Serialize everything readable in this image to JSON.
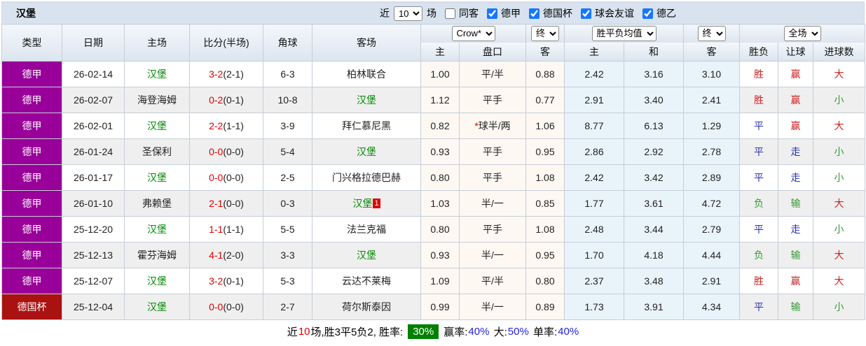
{
  "header": {
    "title": "汉堡",
    "near_label": "近",
    "games_count": "10",
    "games_label": "场",
    "same_away_label": "同客",
    "leagues": [
      "德甲",
      "德国杯",
      "球会友谊",
      "德乙"
    ]
  },
  "selects": {
    "bookmaker": "Crow*",
    "state1": "终",
    "avg": "胜平负均值",
    "state2": "终",
    "scope": "全场"
  },
  "columns": {
    "type": "类型",
    "date": "日期",
    "home": "主场",
    "score": "比分(半场)",
    "corner": "角球",
    "away": "客场",
    "odds_home": "主",
    "handicap": "盘口",
    "odds_away": "客",
    "avg_home": "主",
    "avg_draw": "和",
    "avg_away": "客",
    "result": "胜负",
    "give": "让球",
    "goals": "进球数"
  },
  "rows": [
    {
      "league": "德甲",
      "league_cls": "lg-jia",
      "date": "26-02-14",
      "home": "汉堡",
      "home_cls": "team",
      "score": "3-2",
      "half": "(2-1)",
      "corners": "6-3",
      "away": "柏林联合",
      "away_cls": "",
      "away_badge": "",
      "odds_home": "1.00",
      "star": "",
      "handicap": "平/半",
      "odds_away": "0.88",
      "avg_home": "2.42",
      "avg_draw": "3.16",
      "avg_away": "3.10",
      "result": "胜",
      "result_cls": "t-red",
      "give": "赢",
      "give_cls": "t-red",
      "goals": "大",
      "goals_cls": "t-red"
    },
    {
      "league": "德甲",
      "league_cls": "lg-jia",
      "date": "26-02-07",
      "home": "海登海姆",
      "home_cls": "",
      "score": "0-2",
      "half": "(0-1)",
      "corners": "10-8",
      "away": "汉堡",
      "away_cls": "team",
      "away_badge": "",
      "odds_home": "1.12",
      "star": "",
      "handicap": "平手",
      "odds_away": "0.77",
      "avg_home": "2.91",
      "avg_draw": "3.40",
      "avg_away": "2.41",
      "result": "胜",
      "result_cls": "t-red",
      "give": "赢",
      "give_cls": "t-red",
      "goals": "小",
      "goals_cls": "t-green"
    },
    {
      "league": "德甲",
      "league_cls": "lg-jia",
      "date": "26-02-01",
      "home": "汉堡",
      "home_cls": "team",
      "score": "2-2",
      "half": "(1-1)",
      "corners": "3-9",
      "away": "拜仁慕尼黑",
      "away_cls": "",
      "away_badge": "",
      "odds_home": "0.82",
      "star": "*",
      "handicap": "球半/两",
      "odds_away": "1.06",
      "avg_home": "8.77",
      "avg_draw": "6.13",
      "avg_away": "1.29",
      "result": "平",
      "result_cls": "t-blue",
      "give": "赢",
      "give_cls": "t-red",
      "goals": "大",
      "goals_cls": "t-red"
    },
    {
      "league": "德甲",
      "league_cls": "lg-jia",
      "date": "26-01-24",
      "home": "圣保利",
      "home_cls": "",
      "score": "0-0",
      "half": "(0-0)",
      "corners": "5-4",
      "away": "汉堡",
      "away_cls": "team",
      "away_badge": "",
      "odds_home": "0.93",
      "star": "",
      "handicap": "平手",
      "odds_away": "0.95",
      "avg_home": "2.86",
      "avg_draw": "2.92",
      "avg_away": "2.78",
      "result": "平",
      "result_cls": "t-blue",
      "give": "走",
      "give_cls": "t-blue",
      "goals": "小",
      "goals_cls": "t-green"
    },
    {
      "league": "德甲",
      "league_cls": "lg-jia",
      "date": "26-01-17",
      "home": "汉堡",
      "home_cls": "team",
      "score": "0-0",
      "half": "(0-0)",
      "corners": "2-5",
      "away": "门兴格拉德巴赫",
      "away_cls": "",
      "away_badge": "",
      "odds_home": "0.80",
      "star": "",
      "handicap": "平手",
      "odds_away": "1.08",
      "avg_home": "2.42",
      "avg_draw": "3.42",
      "avg_away": "2.89",
      "result": "平",
      "result_cls": "t-blue",
      "give": "走",
      "give_cls": "t-blue",
      "goals": "小",
      "goals_cls": "t-green"
    },
    {
      "league": "德甲",
      "league_cls": "lg-jia",
      "date": "26-01-10",
      "home": "弗赖堡",
      "home_cls": "",
      "score": "2-1",
      "half": "(0-0)",
      "corners": "0-3",
      "away": "汉堡",
      "away_cls": "team",
      "away_badge": "1",
      "odds_home": "1.03",
      "star": "",
      "handicap": "半/一",
      "odds_away": "0.85",
      "avg_home": "1.77",
      "avg_draw": "3.61",
      "avg_away": "4.72",
      "result": "负",
      "result_cls": "t-green",
      "give": "输",
      "give_cls": "t-green",
      "goals": "大",
      "goals_cls": "t-red"
    },
    {
      "league": "德甲",
      "league_cls": "lg-jia",
      "date": "25-12-20",
      "home": "汉堡",
      "home_cls": "team",
      "score": "1-1",
      "half": "(1-1)",
      "corners": "5-5",
      "away": "法兰克福",
      "away_cls": "",
      "away_badge": "",
      "odds_home": "0.80",
      "star": "",
      "handicap": "平手",
      "odds_away": "1.08",
      "avg_home": "2.48",
      "avg_draw": "3.44",
      "avg_away": "2.79",
      "result": "平",
      "result_cls": "t-blue",
      "give": "走",
      "give_cls": "t-blue",
      "goals": "小",
      "goals_cls": "t-green"
    },
    {
      "league": "德甲",
      "league_cls": "lg-jia",
      "date": "25-12-13",
      "home": "霍芬海姆",
      "home_cls": "",
      "score": "4-1",
      "half": "(2-0)",
      "corners": "3-3",
      "away": "汉堡",
      "away_cls": "team",
      "away_badge": "",
      "odds_home": "0.93",
      "star": "",
      "handicap": "半/一",
      "odds_away": "0.95",
      "avg_home": "1.70",
      "avg_draw": "4.18",
      "avg_away": "4.44",
      "result": "负",
      "result_cls": "t-green",
      "give": "输",
      "give_cls": "t-green",
      "goals": "大",
      "goals_cls": "t-red"
    },
    {
      "league": "德甲",
      "league_cls": "lg-jia",
      "date": "25-12-07",
      "home": "汉堡",
      "home_cls": "team",
      "score": "3-2",
      "half": "(0-1)",
      "corners": "5-3",
      "away": "云达不莱梅",
      "away_cls": "",
      "away_badge": "",
      "odds_home": "1.09",
      "star": "",
      "handicap": "平/半",
      "odds_away": "0.80",
      "avg_home": "2.37",
      "avg_draw": "3.48",
      "avg_away": "2.91",
      "result": "胜",
      "result_cls": "t-red",
      "give": "赢",
      "give_cls": "t-red",
      "goals": "大",
      "goals_cls": "t-red"
    },
    {
      "league": "德国杯",
      "league_cls": "lg-cup",
      "date": "25-12-04",
      "home": "汉堡",
      "home_cls": "team",
      "score": "0-0",
      "half": "(0-0)",
      "corners": "2-7",
      "away": "荷尔斯泰因",
      "away_cls": "",
      "away_badge": "",
      "odds_home": "0.99",
      "star": "",
      "handicap": "半/一",
      "odds_away": "0.89",
      "avg_home": "1.73",
      "avg_draw": "3.91",
      "avg_away": "4.34",
      "result": "平",
      "result_cls": "t-blue",
      "give": "输",
      "give_cls": "t-green",
      "goals": "小",
      "goals_cls": "t-green"
    }
  ],
  "footer": {
    "near": "近",
    "count": "10",
    "mid": "场,胜3平5负2, 胜率:",
    "win_rate": "30%",
    "label2": "赢率:",
    "val2": "40%",
    "sep2": " ",
    "label3": "大:",
    "val3": "50%",
    "sep3": " ",
    "label4": "单率:",
    "val4": "40%"
  }
}
